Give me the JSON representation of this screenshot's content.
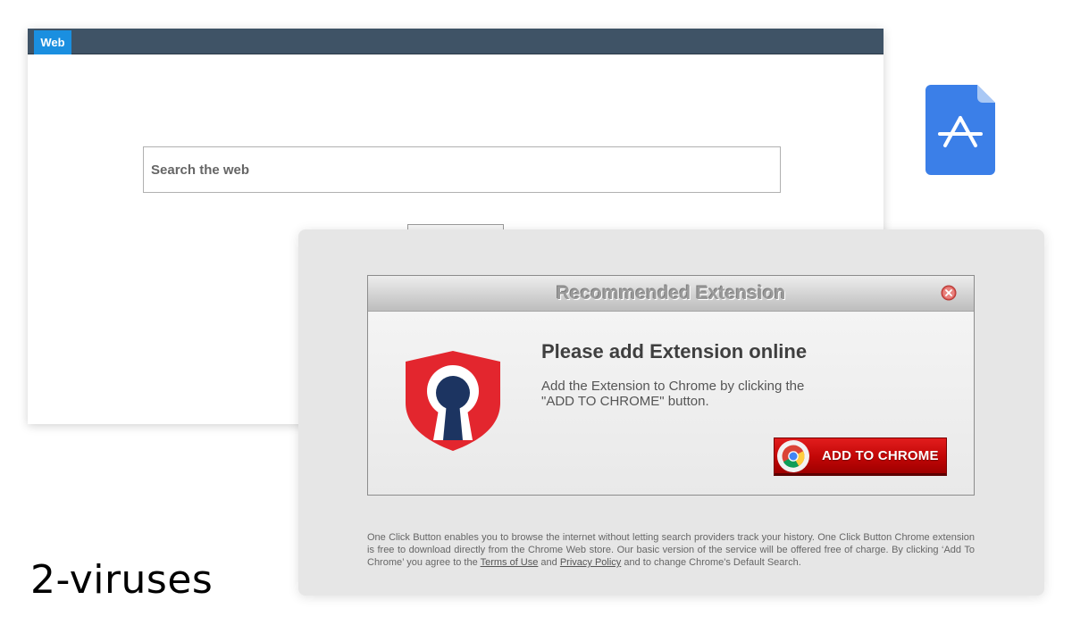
{
  "search_page": {
    "tab_label": "Web",
    "search_placeholder": "Search the web"
  },
  "icons": {
    "app_store": "app-store-icon",
    "shield": "shield-keyhole-icon",
    "close": "close-icon",
    "chrome": "chrome-icon"
  },
  "dialog": {
    "title": "Recommended Extension",
    "heading": "Please add Extension online",
    "body_line1": "Add the Extension to Chrome by clicking the",
    "body_line2": "\"ADD TO CHROME\" button.",
    "cta_label": "ADD TO CHROME"
  },
  "disclaimer": {
    "part1": "One Click Button enables you to browse the internet without letting search providers track your history. One Click Button Chrome extension is free to download directly from the Chrome Web store. Our basic version of the service will be offered free of charge. By clicking ‘Add To Chrome’ you agree to the ",
    "terms_link": "Terms of Use",
    "and": " and ",
    "privacy_link": "Privacy Policy",
    "part2": " and to change Chrome's Default Search."
  },
  "watermark": "2-viruses",
  "colors": {
    "topbar": "#3f5366",
    "tab_blue": "#1a8fe0",
    "app_icon_blue": "#3b7fe8",
    "shield_red": "#e3262e",
    "keyhole_navy": "#1c3461",
    "cta_red": "#c10606"
  }
}
